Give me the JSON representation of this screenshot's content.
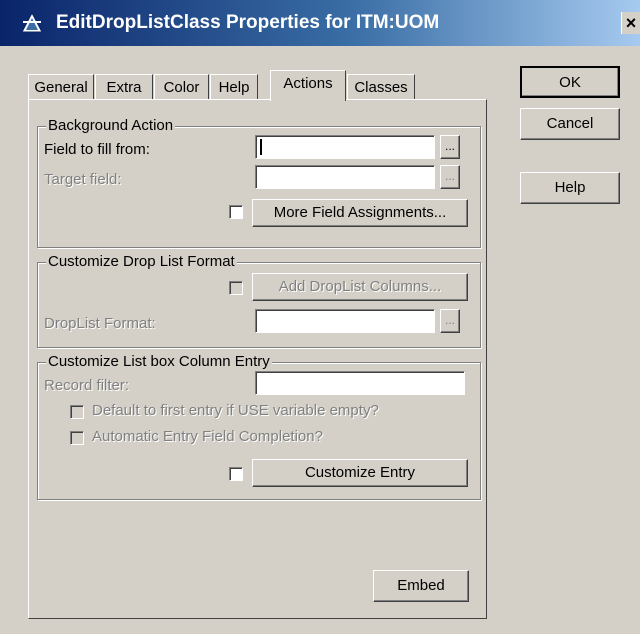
{
  "window": {
    "title": "EditDropListClass Properties for ITM:UOM"
  },
  "tabs": [
    {
      "label": "General"
    },
    {
      "label": "Extra"
    },
    {
      "label": "Color"
    },
    {
      "label": "Help"
    },
    {
      "label": "Actions"
    },
    {
      "label": "Classes"
    }
  ],
  "side_buttons": {
    "ok": "OK",
    "cancel": "Cancel",
    "help": "Help"
  },
  "background_action": {
    "title": "Background Action",
    "field_to_fill_label": "Field to fill from:",
    "field_to_fill_value": "",
    "target_field_label": "Target field:",
    "target_field_value": "",
    "more_assignments_label": "More Field Assignments..."
  },
  "droplist_format": {
    "title": "Customize Drop List Format",
    "add_columns_label": "Add DropList Columns...",
    "format_label": "DropList Format:",
    "format_value": ""
  },
  "listbox_entry": {
    "title": "Customize List box Column Entry",
    "record_filter_label": "Record filter:",
    "record_filter_value": "",
    "default_first_label": "Default to first entry if USE variable empty?",
    "auto_completion_label": "Automatic Entry Field Completion?",
    "customize_entry_label": "Customize Entry"
  },
  "embed_label": "Embed",
  "ellipsis": "..."
}
